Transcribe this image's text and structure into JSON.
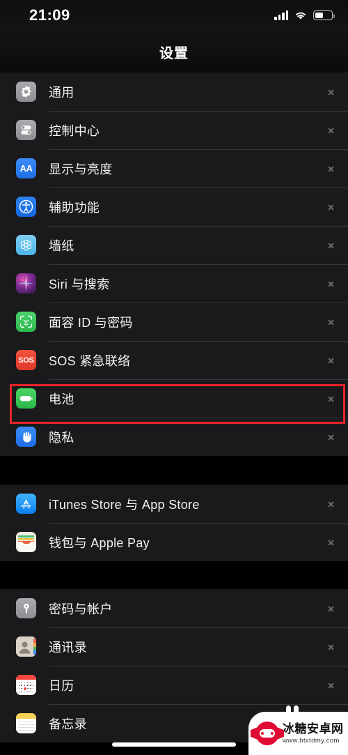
{
  "status_bar": {
    "time": "21:09",
    "signal_icon": "cellular-signal-icon",
    "wifi_icon": "wifi-icon",
    "battery_icon": "battery-icon",
    "battery_level_percent": 50
  },
  "nav": {
    "title": "设置"
  },
  "colors": {
    "highlight": "#e8232a",
    "row_background": "#1a1a1c",
    "page_background": "#000000",
    "separator": "#38383a",
    "label_text": "#f2f2f2"
  },
  "groups": [
    {
      "id": "group-system",
      "rows": [
        {
          "label": "通用",
          "icon": "gear-icon",
          "icon_class": "ic-general"
        },
        {
          "label": "控制中心",
          "icon": "toggles-icon",
          "icon_class": "ic-control"
        },
        {
          "label": "显示与亮度",
          "icon": "display-aa-icon",
          "icon_class": "ic-display"
        },
        {
          "label": "辅助功能",
          "icon": "accessibility-icon",
          "icon_class": "ic-access"
        },
        {
          "label": "墙纸",
          "icon": "wallpaper-icon",
          "icon_class": "ic-wall"
        },
        {
          "label": "Siri 与搜索",
          "icon": "siri-icon",
          "icon_class": "ic-siri"
        },
        {
          "label": "面容 ID 与密码",
          "icon": "face-id-icon",
          "icon_class": "ic-faceid"
        },
        {
          "label": "SOS 紧急联络",
          "icon": "sos-icon",
          "icon_class": "ic-sos"
        },
        {
          "label": "电池",
          "icon": "battery-icon",
          "icon_class": "ic-battery",
          "highlighted": true
        },
        {
          "label": "隐私",
          "icon": "privacy-hand-icon",
          "icon_class": "ic-privacy"
        }
      ]
    },
    {
      "id": "group-store",
      "rows": [
        {
          "label": "iTunes Store 与 App Store",
          "icon": "app-store-icon",
          "icon_class": "ic-appstore"
        },
        {
          "label": "钱包与 Apple Pay",
          "icon": "wallet-icon",
          "icon_class": "ic-wallet"
        }
      ]
    },
    {
      "id": "group-accounts",
      "rows": [
        {
          "label": "密码与帐户",
          "icon": "key-icon",
          "icon_class": "ic-pass"
        },
        {
          "label": "通讯录",
          "icon": "contacts-icon",
          "icon_class": "ic-contacts"
        },
        {
          "label": "日历",
          "icon": "calendar-icon",
          "icon_class": "ic-cal"
        },
        {
          "label": "备忘录",
          "icon": "notes-icon",
          "icon_class": "ic-notes"
        }
      ]
    }
  ],
  "chevron_icon": "chevron-right-icon",
  "home_indicator": "home-indicator",
  "watermark": {
    "site_name": "冰糖安卓网",
    "url": "www.btxtdmy.com",
    "logo_icon": "candy-gamepad-logo-icon"
  }
}
